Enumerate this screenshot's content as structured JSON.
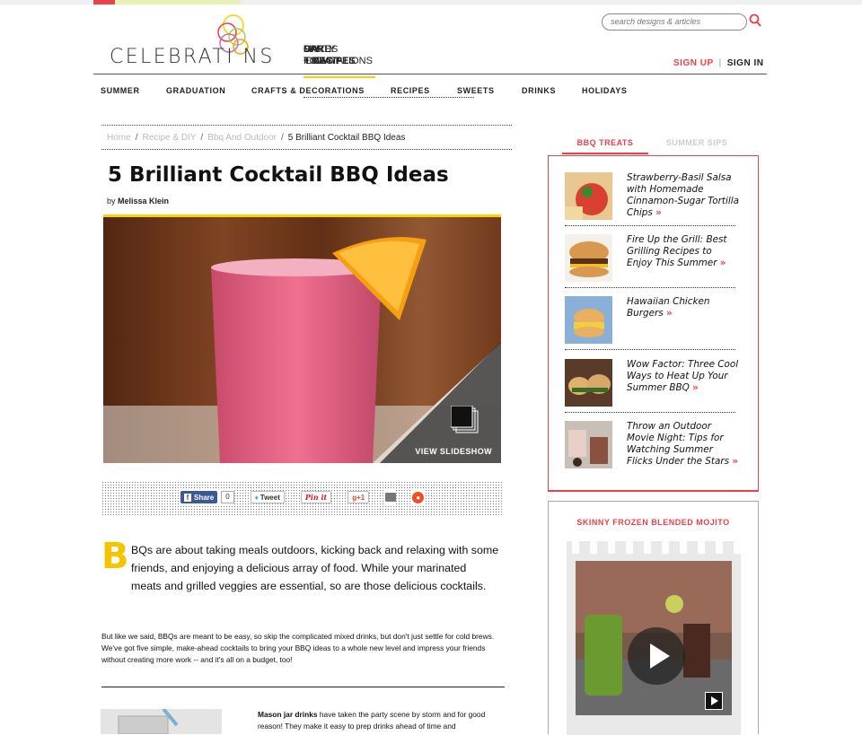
{
  "header": {
    "logo_text": "CELEBRATI NS",
    "nav": [
      {
        "line1": "CARDS",
        "line2": "+ INVITATIONS"
      },
      {
        "line1": "PARTY",
        "line2": "IDEAS!"
      },
      {
        "line1": "DIY",
        "line2": "+ RECIPES"
      },
      {
        "line1": "MAKE",
        "line2": "TODAY!"
      }
    ],
    "search_placeholder": "search designs & articles",
    "sign_up": "SIGN UP",
    "separator": "|",
    "sign_in": "SIGN IN"
  },
  "subnav": [
    "SUMMER",
    "GRADUATION",
    "CRAFTS & DECORATIONS",
    "RECIPES",
    "SWEETS",
    "DRINKS",
    "HOLIDAYS"
  ],
  "breadcrumb": {
    "items": [
      "Home",
      "Recipe & DIY",
      "Bbq And Outdoor"
    ],
    "current": "5 Brilliant Cocktail BBQ Ideas",
    "separator": "/"
  },
  "article": {
    "title": "5 Brilliant Cocktail BBQ Ideas",
    "by": "by",
    "author": "Melissa Klein",
    "slideshow_label": "VIEW SLIDESHOW",
    "dropcap": "B",
    "lead": "BQs are about taking meals outdoors, kicking back and relaxing with some friends, and enjoying a delicious array of food. While your marinated meats and grilled veggies are essential, so are those delicious cocktails.",
    "paragraph2": "But like we said, BBQs are meant to be easy, so skip the complicated mixed drinks, but don't just settle for cold brews. We've got five simple, make-ahead cocktails to bring your BBQ ideas to a whole new level and impress your friends without creating more work -- and it's all on a budget, too!",
    "mason_bold": "Mason jar drinks",
    "mason_rest": " have taken the party scene by storm and for good reason! They make it easy to prep drinks ahead of time and"
  },
  "share": {
    "facebook_label": "Share",
    "facebook_count": "0",
    "tweet_label": "Tweet",
    "pinterest_label": "Pin it",
    "gplus_label": "g+1"
  },
  "sidebar": {
    "tab_active": "BBQ TREATS",
    "tab_inactive": "SUMMER SIPS",
    "items": [
      {
        "title": "Strawberry-Basil Salsa with Homemade Cinnamon-Sugar Tortilla Chips",
        "arrow": "»"
      },
      {
        "title": "Fire Up the Grill: Best Grilling Recipes to Enjoy This Summer",
        "arrow": "»"
      },
      {
        "title": "Hawaiian Chicken Burgers",
        "arrow": "»"
      },
      {
        "title": "Wow Factor: Three Cool Ways to Heat Up Your Summer BBQ",
        "arrow": "»"
      },
      {
        "title": "Throw an Outdoor Movie Night: Tips for Watching Summer Flicks Under the Stars",
        "arrow": "»"
      }
    ],
    "video_title": "SKINNY FROZEN BLENDED MOJITO"
  },
  "colors": {
    "accent_red": "#e8414a",
    "accent_yellow": "#f5d400"
  }
}
